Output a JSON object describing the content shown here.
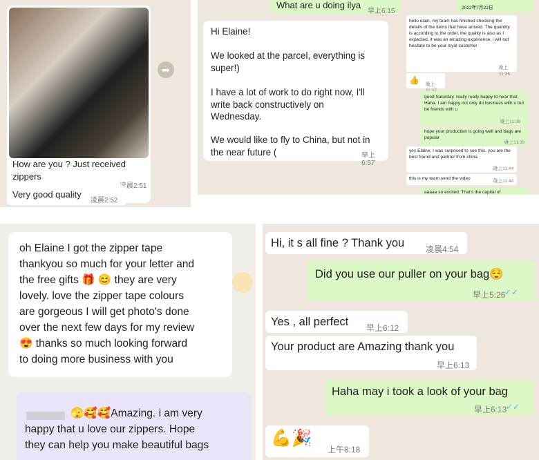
{
  "panel1": {
    "photo_caption": "How are you ? Just received zippers",
    "photo_time": "凌晨2:51",
    "quality_text": "Very good quality",
    "quality_time": "凌晨2:52"
  },
  "panel2": {
    "top_partial_text": "What are u doing ilya",
    "top_partial_time": "早上6:15",
    "message_lines": [
      "Hi Elaine!",
      "We looked at the parcel, everything is super!)",
      "I have a lot of work to do right now, I'll write back constructively on Wednesday.",
      "We would like to fly to China, but not in the near future ("
    ],
    "message_time": "早上6:57",
    "mini_date": "2022年7月22日",
    "mini_msg1": "hello elain, my team has finished checking the details of the items that have arrived. The quantity is according to the order, the quality is also as I expected. it was an amazing experience, i will not hesitate to be your loyal customer",
    "mini_time1": "晚上11:36",
    "mini_thumb_time": "晚上11:37",
    "mini_msg2": "good Saturday. really really happy to hear that. Haha. I am happy not only do business with u but be friends with u",
    "mini_time2": "晚上11:38",
    "mini_msg3": "hope your production is going well and bags are popular",
    "mini_time3": "晚上11:39",
    "mini_msg4": "yes Elaine, I was surprised to see this. you are the best friend and partner from china",
    "mini_time4": "晚上11:44",
    "mini_msg5": "this is my team send the video",
    "mini_time5": "晚上11:44",
    "mini_partial": "aaaaa so excited. That's the capital of"
  },
  "panel3": {
    "review_lines": [
      "oh Elaine I got the zipper tape",
      "thankyou so much for your letter and",
      "the free gifts 🎁 😊 they are very",
      "lovely. love the zipper tape colours",
      "are gorgeous I will get photo's done",
      "over the next few days for my review",
      "😍 thanks so much looking forward",
      "to doing more business with you"
    ],
    "reply_lines": [
      "🫣🥰🥰Amazing. i am very",
      "happy that u love our zippers. Hope",
      "they can help you make beautiful bags"
    ]
  },
  "panel4": {
    "msg1": "Hi, it s all fine ? Thank you",
    "time1": "凌晨4:54",
    "msg2": "Did you use our puller on your bag😌",
    "time2": "早上5:26",
    "msg3": "Yes , all perfect",
    "time3": "早上6:12",
    "msg4": "Your product are Amazing thank you",
    "time4": "早上6:13",
    "msg5": "Haha may i took a look of your bag",
    "time5": "早上6:13",
    "msg6": "💪🎉",
    "time6": "上午8:18"
  },
  "colors": {
    "outgoing": "#dcf8c6",
    "incoming": "#ffffff",
    "read_tick": "#53bdeb"
  }
}
